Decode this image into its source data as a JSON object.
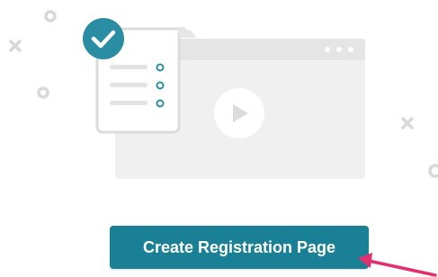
{
  "illustration": {
    "video_window": {
      "icon": "play-icon",
      "menu_icon": "dots-menu-icon"
    },
    "form_document": {
      "badge_icon": "check-icon",
      "rows": 3
    },
    "decorations": [
      "circle",
      "x",
      "circle",
      "x",
      "circle",
      "circle"
    ]
  },
  "cta": {
    "label": "Create Registration Page",
    "color": "#1a8096"
  },
  "pointer": {
    "icon": "arrow-pointer-icon",
    "color": "#e0306e"
  }
}
